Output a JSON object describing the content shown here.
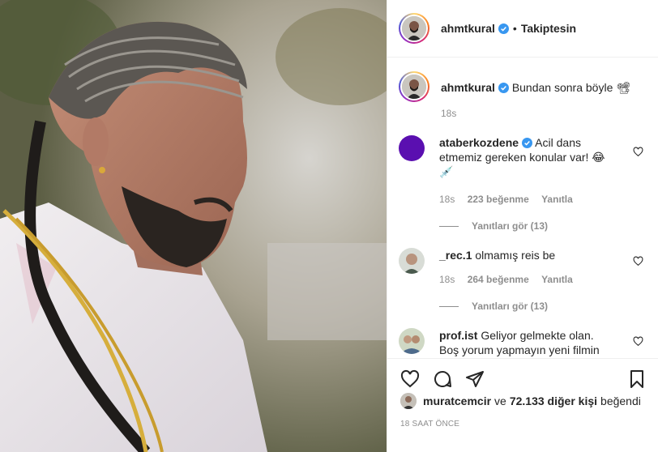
{
  "header": {
    "username": "ahmtkural",
    "separator": "•",
    "follow_status": "Takiptesin"
  },
  "caption": {
    "username": "ahmtkural",
    "text": "Bundan sonra böyle 📽",
    "time": "18s"
  },
  "comments": [
    {
      "username": "ataberkozdene",
      "verified": true,
      "text": "Acil dans etmemiz gereken konular var! 😂💉",
      "time": "18s",
      "likes": "223 beğenme",
      "reply": "Yanıtla",
      "view_replies": "Yanıtları gör (13)"
    },
    {
      "username": "_rec.1",
      "verified": false,
      "text": "olmamış reis be",
      "time": "18s",
      "likes": "264 beğenme",
      "reply": "Yanıtla",
      "view_replies": "Yanıtları gör (13)"
    },
    {
      "username": "prof.ist",
      "verified": false,
      "text": "Geliyor gelmekte olan. Boş yorum yapmayın yeni filmin",
      "time": "",
      "likes": "",
      "reply": "",
      "view_replies": ""
    }
  ],
  "likes_bar": {
    "liker": "muratcemcir",
    "connector": "ve",
    "others": "72.133 diğer kişi",
    "suffix": "beğendi"
  },
  "posted_ago": "18 SAAT ÖNCE",
  "icons": {
    "like": "heart-icon",
    "comment": "comment-icon",
    "share": "share-icon",
    "save": "bookmark-icon",
    "verified": "verified-badge-icon"
  },
  "colors": {
    "verified": "#3897f0",
    "secondary_text": "#8e8e8e",
    "ataberk_avatar": "#5a0fb0"
  }
}
